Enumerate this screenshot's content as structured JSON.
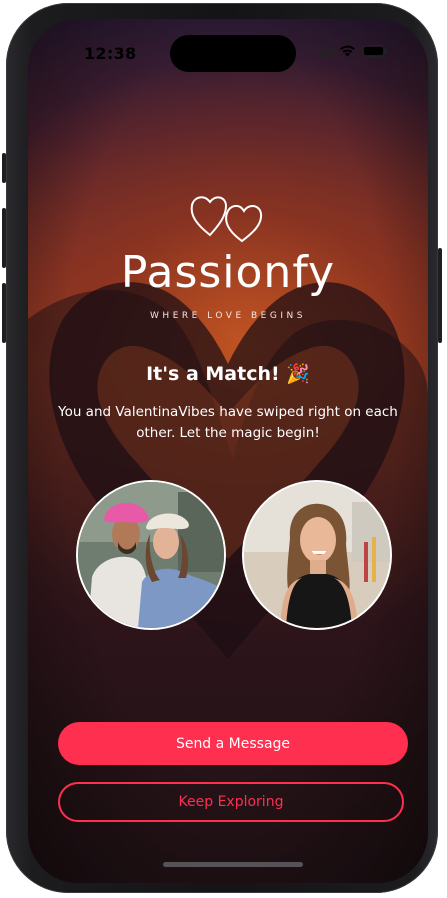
{
  "status_bar": {
    "time": "12:38",
    "icons": [
      "signal-icon",
      "wifi-icon",
      "battery-icon"
    ]
  },
  "brand": {
    "logo_icon": "double-heart-icon",
    "name": "Passionfy",
    "tagline": "WHERE LOVE BEGINS"
  },
  "match": {
    "title": "It's a Match! 🎉",
    "description": "You and ValentinaVibes have swiped right on each other. Let the magic begin!"
  },
  "profiles": [
    {
      "role": "current-user",
      "photo": "couple-photo"
    },
    {
      "role": "matched-user",
      "photo": "woman-smiling-photo"
    }
  ],
  "actions": {
    "send_message": "Send a Message",
    "keep_exploring": "Keep Exploring"
  },
  "colors": {
    "accent": "#ff2f50",
    "text": "#ffffff"
  }
}
